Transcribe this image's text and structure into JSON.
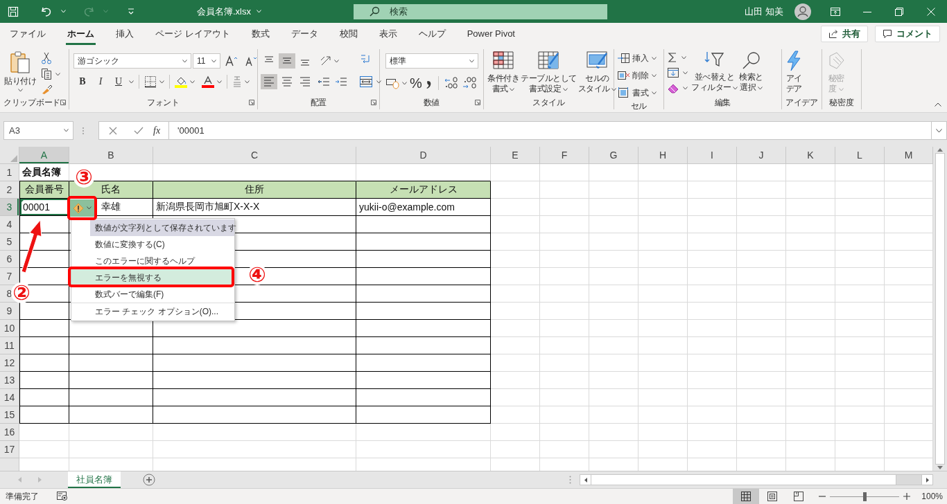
{
  "title_bar": {
    "quick_access": [
      {
        "kind": "save",
        "disabled": false
      },
      {
        "kind": "undo",
        "disabled": false
      },
      {
        "kind": "redo",
        "disabled": true
      },
      {
        "kind": "customize",
        "disabled": false
      }
    ],
    "title": "会員名簿.xlsx",
    "search": {
      "placeholder": "検索"
    },
    "user": "山田 知美"
  },
  "ribbon_tabs": [
    {
      "label": "ファイル",
      "selected": false
    },
    {
      "label": "ホーム",
      "selected": true
    },
    {
      "label": "挿入",
      "selected": false
    },
    {
      "label": "ページ レイアウト",
      "selected": false
    },
    {
      "label": "数式",
      "selected": false
    },
    {
      "label": "データ",
      "selected": false
    },
    {
      "label": "校閲",
      "selected": false
    },
    {
      "label": "表示",
      "selected": false
    },
    {
      "label": "ヘルプ",
      "selected": false
    },
    {
      "label": "Power Pivot",
      "selected": false
    }
  ],
  "share_button": "共有",
  "comment_button": "コメント",
  "ribbon": {
    "clipboard": {
      "label": "クリップボード",
      "paste": "貼り付け"
    },
    "font": {
      "label": "フォント",
      "font_name": "游ゴシック",
      "font_size": "11",
      "styles": [
        "B",
        "I",
        "U"
      ]
    },
    "alignment": {
      "label": "配置",
      "buttons": [
        {
          "kind": "top",
          "selected": false
        },
        {
          "kind": "middle",
          "selected": true
        },
        {
          "kind": "bottom",
          "selected": false
        },
        {
          "kind": "left",
          "selected": true
        },
        {
          "kind": "center",
          "selected": false
        },
        {
          "kind": "right",
          "selected": false
        }
      ]
    },
    "number": {
      "label": "数値",
      "format": "標準",
      "percent": "%"
    },
    "styles": {
      "label": "スタイル",
      "buttons": [
        {
          "kind": "conditional",
          "lines": [
            "条件付き",
            "書式"
          ]
        },
        {
          "kind": "table",
          "lines": [
            "テーブルとして",
            "書式設定"
          ]
        },
        {
          "kind": "cell",
          "lines": [
            "セルの",
            "スタイル"
          ]
        }
      ]
    },
    "cells": {
      "label": "セル",
      "buttons": [
        {
          "kind": "insert",
          "label": "挿入"
        },
        {
          "kind": "delete",
          "label": "削除"
        },
        {
          "kind": "format",
          "label": "書式"
        }
      ]
    },
    "editing": {
      "label": "編集",
      "buttons": [
        {
          "kind": "sort",
          "lines": [
            "並べ替えと",
            "フィルター"
          ]
        },
        {
          "kind": "find",
          "lines": [
            "検索と",
            "選択"
          ]
        }
      ]
    },
    "ideas": {
      "label": "アイデア",
      "lines": [
        "アイ",
        "デア"
      ]
    },
    "sensitivity": {
      "label": "秘密度",
      "lines": [
        "秘密",
        "度"
      ],
      "disabled": true
    }
  },
  "formula_bar": {
    "name_box": "A3",
    "function_symbol": "fx",
    "formula": "'00001"
  },
  "sheet": {
    "columns": [
      {
        "label": "A",
        "selected": true
      },
      {
        "label": "B",
        "selected": false
      },
      {
        "label": "C",
        "selected": false
      },
      {
        "label": "D",
        "selected": false
      },
      {
        "label": "E",
        "selected": false
      },
      {
        "label": "F",
        "selected": false
      },
      {
        "label": "G",
        "selected": false
      },
      {
        "label": "H",
        "selected": false
      },
      {
        "label": "I",
        "selected": false
      },
      {
        "label": "J",
        "selected": false
      },
      {
        "label": "K",
        "selected": false
      },
      {
        "label": "L",
        "selected": false
      },
      {
        "label": "M",
        "selected": false
      }
    ],
    "rows": [
      {
        "label": "1",
        "selected": false
      },
      {
        "label": "2",
        "selected": false
      },
      {
        "label": "3",
        "selected": true
      },
      {
        "label": "4",
        "selected": false
      },
      {
        "label": "5",
        "selected": false
      },
      {
        "label": "6",
        "selected": false
      },
      {
        "label": "7",
        "selected": false
      },
      {
        "label": "8",
        "selected": false
      },
      {
        "label": "9",
        "selected": false
      },
      {
        "label": "10",
        "selected": false
      },
      {
        "label": "11",
        "selected": false
      },
      {
        "label": "12",
        "selected": false
      },
      {
        "label": "13",
        "selected": false
      },
      {
        "label": "14",
        "selected": false
      },
      {
        "label": "15",
        "selected": false
      },
      {
        "label": "16",
        "selected": false
      },
      {
        "label": "17",
        "selected": false
      }
    ],
    "title_cell": "会員名簿",
    "headers": [
      "会員番号",
      "氏名",
      "住所",
      "メールアドレス"
    ],
    "records": [
      [
        {
          "text": "00001",
          "error": true
        },
        {
          "text": "幸雄"
        },
        {
          "text": "新潟県長岡市旭町X-X-X"
        },
        {
          "text": "yukii-o@example.com"
        }
      ]
    ]
  },
  "error_menu": {
    "title": "数値が文字列として保存されています",
    "items": [
      {
        "label": "数値に変換する(C)",
        "selected": false,
        "separator_before": false
      },
      {
        "label": "このエラーに関するヘルプ",
        "selected": false,
        "separator_before": false
      },
      {
        "label": "エラーを無視する",
        "selected": true,
        "separator_before": false
      },
      {
        "label": "数式バーで編集(F)",
        "selected": false,
        "separator_before": false
      },
      {
        "label": "エラー チェック オプション(O)...",
        "selected": false,
        "separator_before": true
      }
    ]
  },
  "annotations": [
    {
      "label": "②"
    },
    {
      "label": "③"
    },
    {
      "label": "④"
    }
  ],
  "sheet_tabs": [
    {
      "label": "社員名簿",
      "selected": true
    }
  ],
  "status_bar": {
    "status": "準備完了",
    "views": [
      {
        "kind": "normal",
        "selected": true
      },
      {
        "kind": "page_layout",
        "selected": false
      },
      {
        "kind": "page_break",
        "selected": false
      }
    ],
    "zoom": {
      "level": 0.5,
      "reading": "100%"
    }
  }
}
